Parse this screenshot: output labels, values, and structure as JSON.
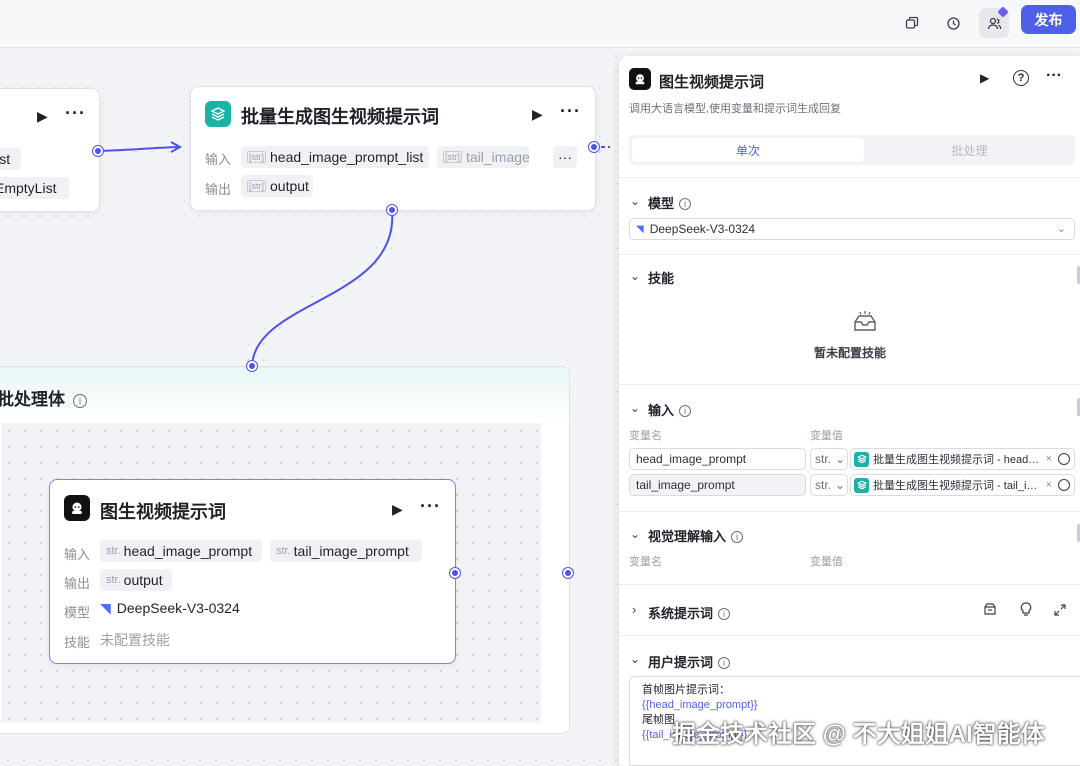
{
  "toolbar": {
    "publish_label": "发布",
    "icons": [
      "copy-icon",
      "history-icon",
      "team-icon"
    ],
    "accent": "#4f5fe8"
  },
  "canvas": {
    "left_node": {
      "tags": [
        "list",
        "EmptyList"
      ]
    },
    "batch_node": {
      "title": "批量生成图生视频提示词",
      "input_label": "输入",
      "output_label": "输出",
      "type_prefix": "[str]",
      "inputs": [
        "head_image_prompt_list",
        "tail_image_prompt_list"
      ],
      "output": "output"
    },
    "group": {
      "title": "批处理体"
    },
    "llm_node": {
      "title": "图生视频提示词",
      "input_label": "输入",
      "output_label": "输出",
      "model_label": "模型",
      "skill_label": "技能",
      "type_prefix": "str.",
      "inputs": [
        "head_image_prompt",
        "tail_image_prompt"
      ],
      "output": "output",
      "model": "DeepSeek-V3-0324",
      "skill": "未配置技能"
    }
  },
  "panel": {
    "title": "图生视频提示词",
    "subtitle": "调用大语言模型,使用变量和提示词生成回复",
    "tabs": [
      "单次",
      "批处理"
    ],
    "model_section": {
      "title": "模型",
      "selected": "DeepSeek-V3-0324"
    },
    "skills_section": {
      "title": "技能",
      "empty_text": "暂未配置技能"
    },
    "input_section": {
      "title": "输入",
      "col_name": "变量名",
      "col_value": "变量值",
      "rows": [
        {
          "name": "head_image_prompt",
          "type": "str.",
          "value": "批量生成图生视频提示词 - head…"
        },
        {
          "name": "tail_image_prompt",
          "type": "str.",
          "value": "批量生成图生视频提示词 - tail_i…"
        }
      ]
    },
    "vision_section": {
      "title": "视觉理解输入",
      "col_name": "变量名",
      "col_value": "变量值"
    },
    "system_prompt_section": {
      "title": "系统提示词"
    },
    "user_prompt_section": {
      "title": "用户提示词",
      "lines": [
        "首帧图片提示词：",
        "{{head_image_prompt}}",
        "尾帧图",
        "{{tail_image_prompt}}"
      ]
    }
  },
  "watermark": "掘金技术社区 @ 不大姐姐AI智能体"
}
